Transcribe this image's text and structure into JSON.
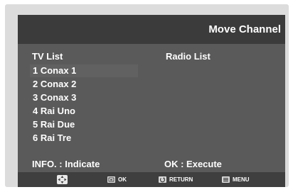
{
  "screen": {
    "title": "Move Channel",
    "tv_list": {
      "header": "TV List",
      "items": [
        "1 Conax 1",
        "2 Conax 2",
        "3 Conax 3",
        "4 Rai Uno",
        "5 Rai Due",
        "6 Rai Tre"
      ]
    },
    "radio_list": {
      "header": "Radio List",
      "items": []
    },
    "footer": {
      "info_label": "INFO. : Indicate",
      "ok_label": "OK : Execute"
    },
    "nav_bar": {
      "ok_label": "OK",
      "return_label": "RETURN",
      "menu_label": "MENU"
    }
  },
  "icons": {
    "move": "move-arrows-icon",
    "ok": "ok-button-icon",
    "return": "return-icon",
    "menu": "menu-icon"
  },
  "colors": {
    "screen_bg": "#5a5a5a",
    "title_bar_bg": "#3b3b3b",
    "selected_row_bg": "#616161",
    "frame": "#dcdcdc",
    "text": "#ffffff"
  }
}
